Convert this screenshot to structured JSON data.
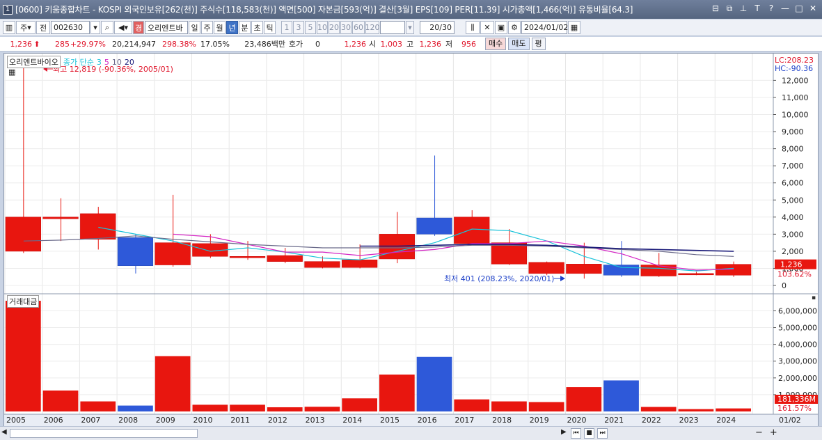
{
  "window": {
    "num": "1",
    "title": "[0600] 키움종합차트 - KOSPI 외국인보유[262(천)] 주식수[118,583(천)] 액면[500] 자본금[593(억)] 결산[3월] EPS[109] PER[11.39] 시가총액[1,466(억)] 유통비율[64.3]",
    "controls": [
      "⊟",
      "⧉",
      "⊥",
      "T",
      "?",
      "—",
      "□",
      "✕"
    ]
  },
  "toolbar": {
    "market": "주",
    "prev_label": "전",
    "code": "002630",
    "stock_name": "오리엔트바",
    "badge": "경",
    "periods": [
      "일",
      "주",
      "월",
      "년",
      "분",
      "초",
      "틱"
    ],
    "selected_period": "년",
    "intervals": [
      "1",
      "3",
      "5",
      "10",
      "20",
      "30",
      "60",
      "120"
    ],
    "count": "20/30",
    "date": "2024/01/02"
  },
  "info": {
    "price": "1,236",
    "change": "285",
    "change_pct": "+29.97%",
    "volume": "20,214,947",
    "vol_pct": "298.38%",
    "turnover": "17.05%",
    "amount": "23,486백만",
    "hoga_label": "호가",
    "hoga_value": "0",
    "hoga_price": "1,236",
    "open_label": "시",
    "open": "1,003",
    "high_label": "고",
    "high": "1,236",
    "low_label": "저",
    "low": "956",
    "buy_label": "매수",
    "sell_label": "매도",
    "eval_label": "평"
  },
  "legend": {
    "name": "오리엔트바이오",
    "ma_label": "종가 단순",
    "ma_periods": [
      "3",
      "5",
      "10",
      "20"
    ]
  },
  "volume_legend": "거래대금",
  "annotations": {
    "high": "최고 12,819 (-90.36%, 2005/01)",
    "low": "최저 401 (208.23%, 2020/01)"
  },
  "right_axis": {
    "lc": "LC:208.23",
    "hc": "HC:-90.36",
    "price_tag": "1,236",
    "pct_tag": "103.62%",
    "vol_tag": "181,336M",
    "vol_pct_tag": "161.57%",
    "price_ticks": [
      "12,000",
      "11,000",
      "10,000",
      "9,000",
      "8,000",
      "7,000",
      "6,000",
      "5,000",
      "4,000",
      "3,000",
      "2,000",
      "1,000",
      "0"
    ],
    "vol_ticks": [
      "6,000,000M",
      "5,000,000M",
      "4,000,000M",
      "3,000,000M",
      "2,000,000M",
      "1,000,000M"
    ],
    "last_date": "01/02"
  },
  "colors": {
    "up": "#e8160f",
    "down": "#2e59d9",
    "ma3": "#19c2d9",
    "ma5": "#d426c4",
    "ma10": "#6a6a8a",
    "ma20": "#1b1b7a"
  },
  "chart_data": {
    "type": "candlestick",
    "x": [
      "2005",
      "2006",
      "2007",
      "2008",
      "2009",
      "2010",
      "2011",
      "2012",
      "2013",
      "2014",
      "2015",
      "2016",
      "2017",
      "2018",
      "2019",
      "2020",
      "2021",
      "2022",
      "2023",
      "2024"
    ],
    "open": [
      2000,
      3900,
      2700,
      2800,
      1200,
      1700,
      1700,
      1400,
      1050,
      1050,
      1550,
      3950,
      2450,
      1250,
      700,
      700,
      1200,
      550,
      700,
      600
    ],
    "close": [
      4000,
      4000,
      4200,
      1150,
      2500,
      2450,
      1700,
      1750,
      1400,
      1500,
      3000,
      3000,
      4000,
      2500,
      1350,
      1250,
      600,
      1200,
      700,
      1236
    ],
    "high": [
      12819,
      5100,
      4600,
      3000,
      5300,
      3000,
      2600,
      2200,
      1700,
      2400,
      4300,
      7600,
      4400,
      3300,
      1400,
      2500,
      2600,
      1900,
      800,
      1400
    ],
    "low": [
      1900,
      2600,
      2100,
      700,
      1100,
      1600,
      1500,
      1300,
      1000,
      1000,
      1300,
      2900,
      2400,
      1200,
      600,
      401,
      500,
      500,
      600,
      500
    ],
    "volume_amount_M": [
      6600000,
      1250000,
      600000,
      350000,
      3300000,
      400000,
      400000,
      250000,
      280000,
      780000,
      2200000,
      3250000,
      720000,
      600000,
      560000,
      1450000,
      1850000,
      270000,
      140000,
      181336
    ],
    "ma": {
      "3": [
        null,
        null,
        3400,
        3000,
        2600,
        2000,
        2200,
        1950,
        1600,
        1500,
        2000,
        2500,
        3300,
        3200,
        2600,
        1700,
        1050,
        1000,
        850,
        1000
      ],
      "5": [
        null,
        null,
        null,
        null,
        3000,
        2850,
        2400,
        1950,
        1950,
        1750,
        1950,
        2100,
        2450,
        2450,
        2600,
        2300,
        1850,
        1150,
        900,
        950
      ],
      "10": [
        2600,
        2650,
        2750,
        2900,
        2700,
        2550,
        2400,
        2300,
        2200,
        2200,
        2200,
        2250,
        2350,
        2350,
        2300,
        2200,
        2100,
        2000,
        1800,
        1700
      ],
      "20": [
        null,
        null,
        null,
        null,
        null,
        null,
        null,
        null,
        null,
        2300,
        2300,
        2350,
        2400,
        2400,
        2350,
        2250,
        2150,
        2100,
        2050,
        2000
      ]
    },
    "ylim": [
      0,
      12819
    ],
    "volume_ylim": [
      0,
      6600000
    ]
  }
}
